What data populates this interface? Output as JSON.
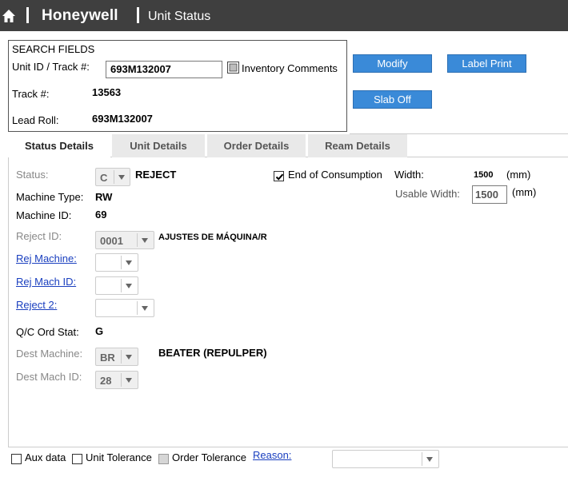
{
  "header": {
    "brand": "Honeywell",
    "title": "Unit Status",
    "home_icon": "home-icon",
    "background": "#3f3f3f"
  },
  "search": {
    "heading": "SEARCH FIELDS",
    "unit_id_label": "Unit ID / Track #:",
    "unit_id_value": "693M132007",
    "inventory_comments_label": "Inventory Comments",
    "track_label": "Track #:",
    "track_value": "13563",
    "lead_roll_label": "Lead Roll:",
    "lead_roll_value": "693M132007"
  },
  "buttons": {
    "modify": "Modify",
    "label_print": "Label Print",
    "slab_off": "Slab Off",
    "color": "#3a8ad8"
  },
  "tabs": [
    {
      "label": "Status Details",
      "active": true
    },
    {
      "label": "Unit Details",
      "active": false
    },
    {
      "label": "Order Details",
      "active": false
    },
    {
      "label": "Ream Details",
      "active": false
    }
  ],
  "details": {
    "status_label": "Status:",
    "status_value": "C",
    "status_text": "REJECT",
    "end_of_consumption_label": "End of Consumption",
    "end_of_consumption_checked": true,
    "width_label": "Width:",
    "width_value": "1500",
    "width_unit": "(mm)",
    "usable_width_label": "Usable Width:",
    "usable_width_value": "1500",
    "usable_width_unit": "(mm)",
    "machine_type_label": "Machine Type:",
    "machine_type_value": "RW",
    "machine_id_label": "Machine ID:",
    "machine_id_value": "69",
    "reject_id_label": "Reject ID:",
    "reject_id_value": "0001",
    "reject_id_text": "AJUSTES DE MÁQUINA/R",
    "rej_machine_label": "Rej Machine:",
    "rej_mach_id_label": "Rej Mach ID:",
    "reject_2_label": "Reject 2:",
    "qc_ord_stat_label": "Q/C Ord Stat:",
    "qc_ord_stat_value": "G",
    "dest_machine_label": "Dest Machine:",
    "dest_machine_value": "BR",
    "dest_machine_text": "BEATER (REPULPER)",
    "dest_mach_id_label": "Dest Mach ID:",
    "dest_mach_id_value": "28"
  },
  "footer": {
    "aux_data_label": "Aux data",
    "unit_tolerance_label": "Unit Tolerance",
    "order_tolerance_label": "Order Tolerance",
    "reason_label": "Reason:"
  }
}
